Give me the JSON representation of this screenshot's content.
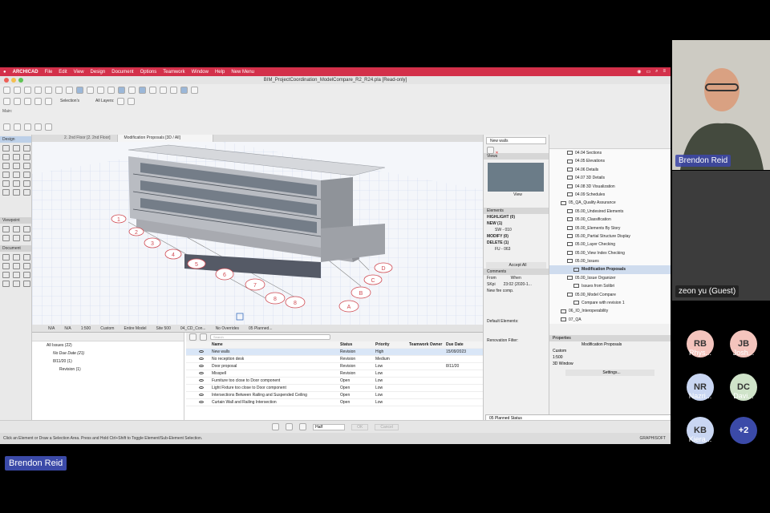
{
  "menubar": {
    "app_name": "ARCHICAD",
    "items": [
      "File",
      "Edit",
      "View",
      "Design",
      "Document",
      "Options",
      "Teamwork",
      "Window",
      "Help",
      "New Menu"
    ]
  },
  "window": {
    "title": "BIM_ProjectCoordination_ModelCompare_R2_R24.pla [Read-only]"
  },
  "toolbar": {
    "selection_label": "Selection's",
    "layers_label": "All Layers:",
    "main_label": "Main:"
  },
  "toolbox": {
    "design_header": "Design",
    "viewpoint_header": "Viewpoint",
    "document_header": "Document"
  },
  "tabs": {
    "floor": "2. 2nd Floor [2. 2nd Floor]",
    "proposals": "Modification Proposals [3D / All]"
  },
  "viewstatus": {
    "na1": "N/A",
    "na2": "N/A",
    "scale": "1:500",
    "custom": "Custom",
    "entire_model": "Entire Model",
    "site": "Site 500",
    "layer": "04_CD_Con...",
    "overrides": "No Overrides",
    "planned": "05 Planned..."
  },
  "bubbles": {
    "row_numbers": [
      "1",
      "2",
      "3",
      "4",
      "5",
      "6",
      "7",
      "8",
      "8"
    ],
    "letters": [
      "D",
      "C",
      "B",
      "A"
    ]
  },
  "issues_tree": {
    "all": "All Issues (22)",
    "no_due": "No Due Date (21)",
    "date": "8/11/20 (1)",
    "revision": "Revision (1)"
  },
  "issues_table": {
    "search_placeholder": "Search",
    "headers": [
      "Name",
      "Status",
      "Priority",
      "Teamwork Owner",
      "Due Date"
    ],
    "rows": [
      {
        "name": "New walls",
        "status": "Revision",
        "priority": "High",
        "owner": "",
        "due": "15/09/2023"
      },
      {
        "name": "No reception desk",
        "status": "Revision",
        "priority": "Medium",
        "owner": "",
        "due": ""
      },
      {
        "name": "Door proposal",
        "status": "Revision",
        "priority": "Low",
        "owner": "",
        "due": "8/11/20"
      },
      {
        "name": "Misspell",
        "status": "Revision",
        "priority": "Low",
        "owner": "",
        "due": ""
      },
      {
        "name": "Furniture too close to Door component",
        "status": "Open",
        "priority": "Low",
        "owner": "",
        "due": ""
      },
      {
        "name": "Light Fixture too close to Door component",
        "status": "Open",
        "priority": "Low",
        "owner": "",
        "due": ""
      },
      {
        "name": "Intersections Between Railing and Suspended Ceiling",
        "status": "Open",
        "priority": "Low",
        "owner": "",
        "due": ""
      },
      {
        "name": "Curtain Wall and Railing Intersection",
        "status": "Open",
        "priority": "Low",
        "owner": "",
        "due": ""
      }
    ]
  },
  "bottombar": {
    "half": "Half",
    "ok": "OK",
    "cancel": "Cancel"
  },
  "statusbar": {
    "hint": "Click an Element or Draw a Selection Area. Press and Hold Ctrl+Shift to Toggle Element/Sub-Element Selection.",
    "brand": "GRAPHISOFT"
  },
  "midpal": {
    "title": "New walls",
    "views_header": "Views",
    "view_caption": "View",
    "elements_header": "Elements",
    "highlight": "HIGHLIGHT (0)",
    "new": "NEW (1)",
    "sw": "SW - 010",
    "modify": "MODIFY (0)",
    "delete": "DELETE (1)",
    "fu": "FU - 063",
    "accept_all": "Accept All",
    "comments_header": "Comments",
    "from": "From",
    "when": "When",
    "comment_author": "SKpi",
    "comment_time": "23:02 (2020-1...",
    "comment_text": "New fire comp.",
    "default_elements": "Default Elements:",
    "renovation_filter": "Renovation Filter:",
    "renovation_value": "05 Planned Status"
  },
  "navigator": {
    "items": [
      {
        "label": "04.04 Sections",
        "indent": 1,
        "sel": false
      },
      {
        "label": "04.05 Elevations",
        "indent": 1,
        "sel": false
      },
      {
        "label": "04.06 Details",
        "indent": 1,
        "sel": false
      },
      {
        "label": "04.07 3D Details",
        "indent": 1,
        "sel": false
      },
      {
        "label": "04.08 3D Visualization",
        "indent": 1,
        "sel": false
      },
      {
        "label": "04.09 Schedules",
        "indent": 1,
        "sel": false
      },
      {
        "label": "05_QA_Quality Assurance",
        "indent": 0,
        "sel": false
      },
      {
        "label": "05.00_Undesired Elements",
        "indent": 1,
        "sel": false
      },
      {
        "label": "05.00_Classification",
        "indent": 1,
        "sel": false
      },
      {
        "label": "05.00_Elements By Story",
        "indent": 1,
        "sel": false
      },
      {
        "label": "05.00_Partial Structure Display",
        "indent": 1,
        "sel": false
      },
      {
        "label": "05.00_Layer Checking",
        "indent": 1,
        "sel": false
      },
      {
        "label": "05.00_View Index Checking",
        "indent": 1,
        "sel": false
      },
      {
        "label": "05.00_Issues",
        "indent": 1,
        "sel": false
      },
      {
        "label": "Modification Proposals",
        "indent": 2,
        "sel": true
      },
      {
        "label": "05.00_Issue Organizer",
        "indent": 1,
        "sel": false
      },
      {
        "label": "Issues from Solibri",
        "indent": 2,
        "sel": false
      },
      {
        "label": "05.00_Model Compare",
        "indent": 1,
        "sel": false
      },
      {
        "label": "Compare with revision 1",
        "indent": 2,
        "sel": false
      },
      {
        "label": "06_IO_Interoperability",
        "indent": 0,
        "sel": false
      },
      {
        "label": "07_QA",
        "indent": 0,
        "sel": false
      }
    ]
  },
  "properties": {
    "header": "Properties",
    "name": "Modification Proposals",
    "custom": "Custom",
    "scale": "1:500",
    "window": "3D Window",
    "settings": "Settings..."
  },
  "meeting": {
    "speaker": "Brendon Reid",
    "guest": "zeon yu (Guest)",
    "presenter": "Brendon Reid",
    "participants": [
      {
        "initials": "RB",
        "name": "Rhys...",
        "color": "#f4c4bd"
      },
      {
        "initials": "JB",
        "name": "Josh...",
        "color": "#f4c4bd"
      },
      {
        "initials": "NR",
        "name": "Nazri...",
        "color": "#c9d6f2"
      },
      {
        "initials": "DC",
        "name": "Davi...",
        "color": "#cfe3c9"
      },
      {
        "initials": "KB",
        "name": "Kiera...",
        "color": "#c9d6f2"
      }
    ],
    "more": "+2",
    "more_color": "#3b4aa8"
  }
}
